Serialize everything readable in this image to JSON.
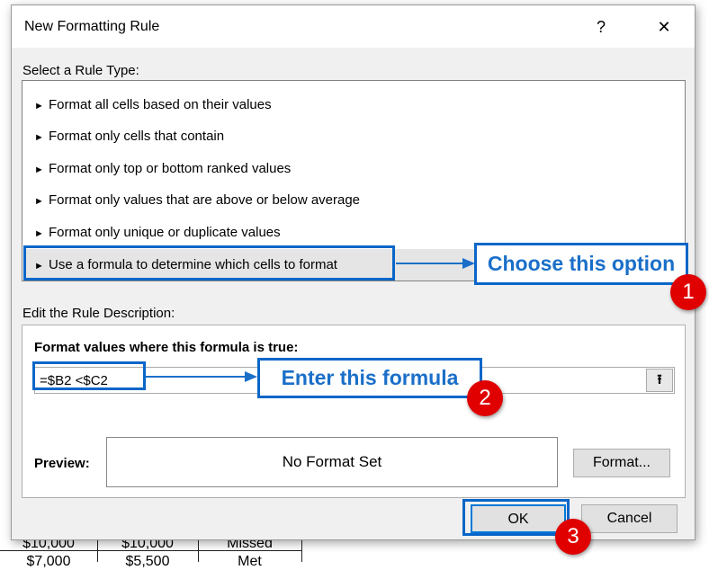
{
  "dialog": {
    "title": "New Formatting Rule",
    "help": "?",
    "close": "✕"
  },
  "rule_type": {
    "label": "Select a Rule Type:",
    "items": [
      "Format all cells based on their values",
      "Format only cells that contain",
      "Format only top or bottom ranked values",
      "Format only values that are above or below average",
      "Format only unique or duplicate values",
      "Use a formula to determine which cells to format"
    ],
    "selected_index": 5
  },
  "description": {
    "label": "Edit the Rule Description:",
    "formula_label": "Format values where this formula is true:",
    "formula_value": "=$B2 <$C2",
    "ref_icon": "⭱"
  },
  "preview": {
    "label": "Preview:",
    "text": "No Format Set",
    "format_button": "Format..."
  },
  "buttons": {
    "ok": "OK",
    "cancel": "Cancel"
  },
  "annotations": {
    "callout1": "Choose this option",
    "callout2": "Enter this formula",
    "badge1": "1",
    "badge2": "2",
    "badge3": "3",
    "accent": "#0a66c8",
    "badge_color": "#e00000"
  },
  "sheet": {
    "rows": [
      [
        "$10,000",
        "$10,000",
        "Missed"
      ],
      [
        "$7,000",
        "$5,500",
        "Met"
      ]
    ]
  }
}
